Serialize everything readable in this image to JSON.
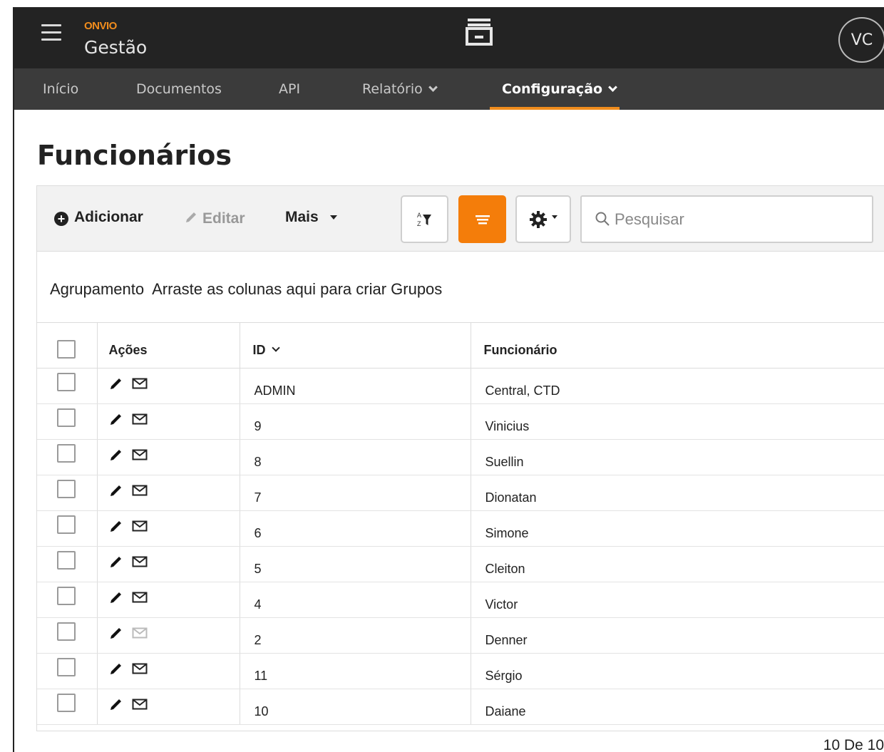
{
  "header": {
    "brand": "ONVIO",
    "app_name": "Gestão",
    "avatar_initials": "VC",
    "accent_color": "#f08c1d"
  },
  "nav": {
    "items": [
      {
        "label": "Início"
      },
      {
        "label": "Documentos"
      },
      {
        "label": "API"
      },
      {
        "label": "Relatório"
      },
      {
        "label": "Configuração"
      }
    ],
    "active": "Configuração"
  },
  "page": {
    "title": "Funcionários"
  },
  "toolbar": {
    "add_label": "Adicionar",
    "edit_label": "Editar",
    "more_label": "Mais",
    "search_placeholder": "Pesquisar"
  },
  "grouping": {
    "text": "Agrupamento  Arraste as colunas aqui para criar Grupos"
  },
  "table": {
    "columns": {
      "actions": "Ações",
      "id": "ID",
      "employee": "Funcionário"
    },
    "rows": [
      {
        "id": "ADMIN",
        "name": "Central, CTD",
        "mail_enabled": true
      },
      {
        "id": "9",
        "name": "Vinicius",
        "mail_enabled": true
      },
      {
        "id": "8",
        "name": "Suellin",
        "mail_enabled": true
      },
      {
        "id": "7",
        "name": "Dionatan",
        "mail_enabled": true
      },
      {
        "id": "6",
        "name": "Simone",
        "mail_enabled": true
      },
      {
        "id": "5",
        "name": "Cleiton",
        "mail_enabled": true
      },
      {
        "id": "4",
        "name": "Victor",
        "mail_enabled": true
      },
      {
        "id": "2",
        "name": "Denner",
        "mail_enabled": false
      },
      {
        "id": "11",
        "name": "Sérgio",
        "mail_enabled": true
      },
      {
        "id": "10",
        "name": "Daiane",
        "mail_enabled": true
      }
    ]
  },
  "pager": {
    "text": "10 De 10"
  }
}
